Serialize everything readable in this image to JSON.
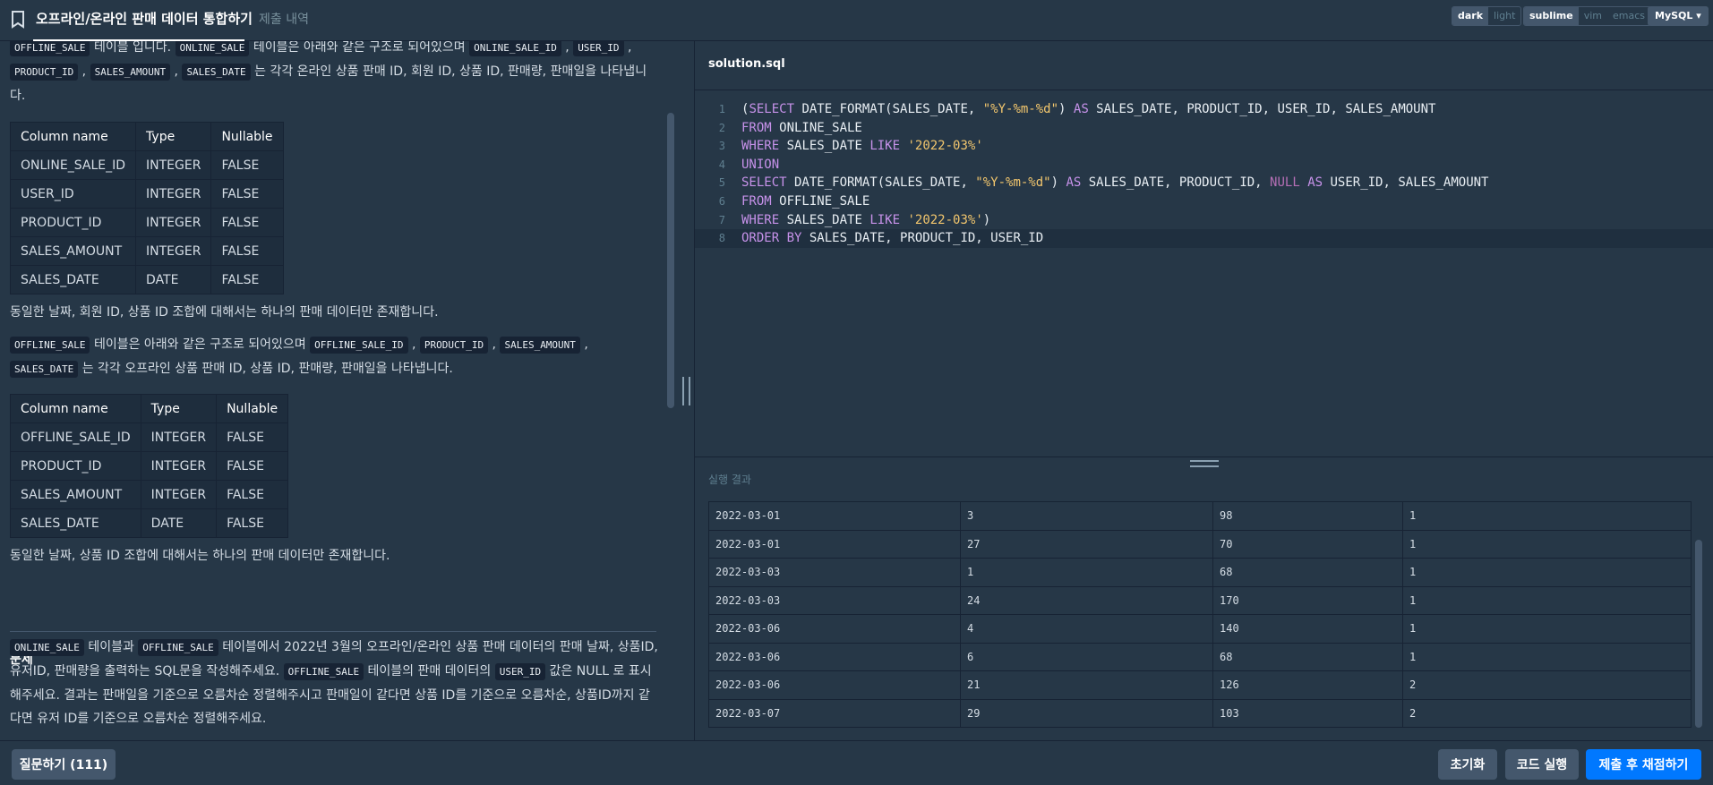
{
  "header": {
    "active_tab": "오프라인/온라인 판매 데이터 통합하기",
    "inactive_tab": "제출 내역",
    "themes": [
      "dark",
      "light"
    ],
    "keymaps": [
      "sublime",
      "vim",
      "emacs"
    ],
    "language": "MySQL"
  },
  "description": {
    "p1_a": "테이블 입니다.",
    "p1_b": "테이블은 아래와 같은 구조로 되어있으며",
    "p1_c": "는 각각 온라인 상품 판매 ID, 회원 ID, 상품 ID, 판매량,",
    "p1_d": "판매일을 나타냅니다.",
    "code_offline_sale": "OFFLINE_SALE",
    "code_online_sale": "ONLINE_SALE",
    "code_online_sale_id": "ONLINE_SALE_ID",
    "code_user_id": "USER_ID",
    "code_product_id": "PRODUCT_ID",
    "code_sales_amount": "SALES_AMOUNT",
    "code_sales_date": "SALES_DATE",
    "code_offline_sale_id": "OFFLINE_SALE_ID",
    "p2": "동일한 날짜, 회원 ID, 상품 ID 조합에 대해서는 하나의 판매 데이터만 존재합니다.",
    "p3_a": "테이블은 아래와 같은 구조로 되어있으며",
    "p3_b": "는 각각 오프라인 상품 판매 ID, 상품 ID, 판매량, 판매일을 나타냅니다.",
    "p4": "동일한 날짜, 상품 ID 조합에 대해서는 하나의 판매 데이터만 존재합니다.",
    "section_title": "문제",
    "q_a": "테이블과",
    "q_b": "테이블에서 2022년 3월의 오프라인/온라인 상품 판매 데이터의 판매 날짜,",
    "q_c": "상품ID, 유저ID, 판매량을 출력하는 SQL문을 작성해주세요.",
    "q_d": "테이블의 판매 데이터의",
    "q_e": "값은",
    "q_f": "NULL 로 표시해주세요. 결과는 판매일을 기준으로 오름차순 정렬해주시고 판매일이 같다면 상품 ID를 기준으로 오름차",
    "q_g": "순, 상품ID까지 같다면 유저 ID를 기준으로 오름차순 정렬해주세요."
  },
  "online_table": {
    "headers": [
      "Column name",
      "Type",
      "Nullable"
    ],
    "rows": [
      [
        "ONLINE_SALE_ID",
        "INTEGER",
        "FALSE"
      ],
      [
        "USER_ID",
        "INTEGER",
        "FALSE"
      ],
      [
        "PRODUCT_ID",
        "INTEGER",
        "FALSE"
      ],
      [
        "SALES_AMOUNT",
        "INTEGER",
        "FALSE"
      ],
      [
        "SALES_DATE",
        "DATE",
        "FALSE"
      ]
    ]
  },
  "offline_table": {
    "headers": [
      "Column name",
      "Type",
      "Nullable"
    ],
    "rows": [
      [
        "OFFLINE_SALE_ID",
        "INTEGER",
        "FALSE"
      ],
      [
        "PRODUCT_ID",
        "INTEGER",
        "FALSE"
      ],
      [
        "SALES_AMOUNT",
        "INTEGER",
        "FALSE"
      ],
      [
        "SALES_DATE",
        "DATE",
        "FALSE"
      ]
    ]
  },
  "editor": {
    "filename": "solution.sql",
    "lines": [
      [
        [
          "p",
          "("
        ],
        [
          "k",
          "SELECT"
        ],
        [
          "p",
          " DATE_FORMAT(SALES_DATE, "
        ],
        [
          "s",
          "\"%Y-%m-%d\""
        ],
        [
          "p",
          ") "
        ],
        [
          "k",
          "AS"
        ],
        [
          "p",
          " SALES_DATE, PRODUCT_ID, USER_ID, SALES_AMOUNT"
        ]
      ],
      [
        [
          "k",
          "FROM"
        ],
        [
          "p",
          " ONLINE_SALE"
        ]
      ],
      [
        [
          "k",
          "WHERE"
        ],
        [
          "p",
          " SALES_DATE "
        ],
        [
          "k",
          "LIKE"
        ],
        [
          "p",
          " "
        ],
        [
          "s",
          "'2022-03%'"
        ]
      ],
      [
        [
          "k",
          "UNION"
        ]
      ],
      [
        [
          "k",
          "SELECT"
        ],
        [
          "p",
          " DATE_FORMAT(SALES_DATE, "
        ],
        [
          "s",
          "\"%Y-%m-%d\""
        ],
        [
          "p",
          ") "
        ],
        [
          "k",
          "AS"
        ],
        [
          "p",
          " SALES_DATE, PRODUCT_ID, "
        ],
        [
          "n",
          "NULL"
        ],
        [
          "p",
          " "
        ],
        [
          "k",
          "AS"
        ],
        [
          "p",
          " USER_ID, SALES_AMOUNT"
        ]
      ],
      [
        [
          "k",
          "FROM"
        ],
        [
          "p",
          " OFFLINE_SALE"
        ]
      ],
      [
        [
          "k",
          "WHERE"
        ],
        [
          "p",
          " SALES_DATE "
        ],
        [
          "k",
          "LIKE"
        ],
        [
          "p",
          " "
        ],
        [
          "s",
          "'2022-03%'"
        ],
        [
          "p",
          ")"
        ]
      ],
      [
        [
          "k",
          "ORDER BY"
        ],
        [
          "p",
          " SALES_DATE, PRODUCT_ID, USER_ID"
        ]
      ]
    ]
  },
  "result": {
    "title": "실행 결과",
    "rows": [
      [
        "2022-03-01",
        "3",
        "98",
        "1"
      ],
      [
        "2022-03-01",
        "27",
        "70",
        "1"
      ],
      [
        "2022-03-03",
        "1",
        "68",
        "1"
      ],
      [
        "2022-03-03",
        "24",
        "170",
        "1"
      ],
      [
        "2022-03-06",
        "4",
        "140",
        "1"
      ],
      [
        "2022-03-06",
        "6",
        "68",
        "1"
      ],
      [
        "2022-03-06",
        "21",
        "126",
        "2"
      ],
      [
        "2022-03-07",
        "29",
        "103",
        "2"
      ]
    ]
  },
  "footer": {
    "question_button": "질문하기 (111)",
    "reset_button": "초기화",
    "run_button": "코드 실행",
    "submit_button": "제출 후 채점하기"
  }
}
